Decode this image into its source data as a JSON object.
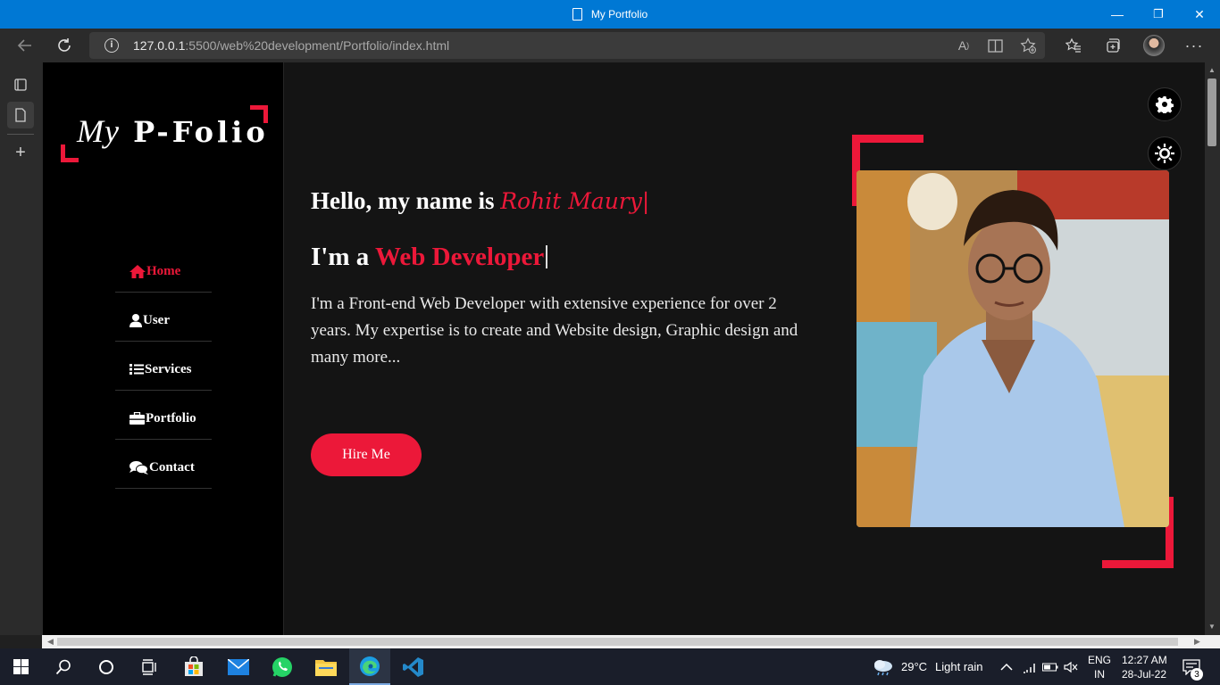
{
  "window": {
    "title": "My Portfolio",
    "controls": {
      "minimize": "—",
      "maximize": "❐",
      "close": "✕"
    }
  },
  "address_bar": {
    "url_host": "127.0.0.1",
    "url_rest": ":5500/web%20development/Portfolio/index.html"
  },
  "site": {
    "logo_my": "My",
    "logo_rest": " P-Folio",
    "menu": [
      {
        "label": "Home",
        "icon": "home-icon",
        "active": true
      },
      {
        "label": "User",
        "icon": "user-icon",
        "active": false
      },
      {
        "label": "Services",
        "icon": "list-icon",
        "active": false
      },
      {
        "label": "Portfolio",
        "icon": "briefcase-icon",
        "active": false
      },
      {
        "label": "Contact",
        "icon": "comments-icon",
        "active": false
      }
    ],
    "hello_prefix": "Hello, my name is ",
    "name": "Rohit Maury|",
    "role_prefix": "I'm a ",
    "role": "Web Developer",
    "description": "I'm a Front-end Web Developer with extensive experience for over 2 years. My expertise is to create and Website design, Graphic design and many more...",
    "hire_button": "Hire Me",
    "accent_color": "#ec1839"
  },
  "taskbar": {
    "weather_temp": "29°C",
    "weather_text": "Light rain",
    "lang1": "ENG",
    "lang2": "IN",
    "time": "12:27 AM",
    "date": "28-Jul-22",
    "notification_count": "3"
  }
}
